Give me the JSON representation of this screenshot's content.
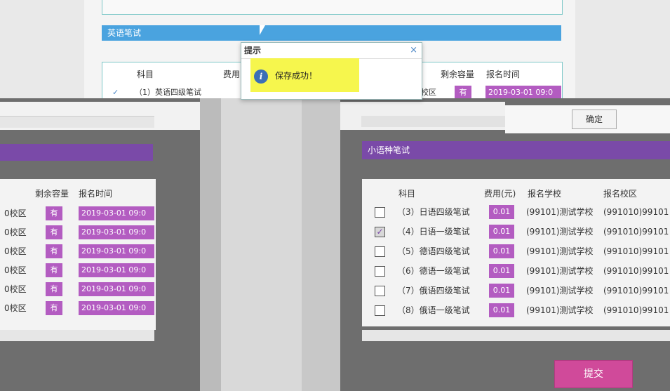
{
  "top": {
    "section_title": "英语笔试",
    "headers": {
      "subject": "科目",
      "fee": "费用",
      "remaining": "剩余容量",
      "time": "报名时间"
    },
    "row": {
      "subject": "（1）英语四级笔试",
      "campus_suffix": "校区",
      "remaining": "有",
      "time": "2019-03-01 09:0"
    }
  },
  "dialog": {
    "title": "提示",
    "close": "×",
    "icon": "info-icon",
    "message": "保存成功！"
  },
  "ok_button": "确定",
  "right": {
    "section_title": "小语种笔试",
    "headers": {
      "subject": "科目",
      "fee": "费用(元)",
      "school": "报名学校",
      "campus": "报名校区"
    },
    "rows": [
      {
        "checked": false,
        "subject": "（3）日语四级笔试",
        "fee": "0.01",
        "school": "(99101)测试学校",
        "campus": "(991010)99101"
      },
      {
        "checked": true,
        "subject": "（4）日语一级笔试",
        "fee": "0.01",
        "school": "(99101)测试学校",
        "campus": "(991010)99101"
      },
      {
        "checked": false,
        "subject": "（5）德语四级笔试",
        "fee": "0.01",
        "school": "(99101)测试学校",
        "campus": "(991010)99101"
      },
      {
        "checked": false,
        "subject": "（6）德语一级笔试",
        "fee": "0.01",
        "school": "(99101)测试学校",
        "campus": "(991010)99101"
      },
      {
        "checked": false,
        "subject": "（7）俄语四级笔试",
        "fee": "0.01",
        "school": "(99101)测试学校",
        "campus": "(991010)99101"
      },
      {
        "checked": false,
        "subject": "（8）俄语一级笔试",
        "fee": "0.01",
        "school": "(99101)测试学校",
        "campus": "(991010)99101"
      }
    ]
  },
  "left": {
    "headers": {
      "remaining": "剩余容量",
      "time": "报名时间"
    },
    "rows": [
      {
        "campus": "0校区",
        "remaining": "有",
        "time": "2019-03-01 09:0"
      },
      {
        "campus": "0校区",
        "remaining": "有",
        "time": "2019-03-01 09:0"
      },
      {
        "campus": "0校区",
        "remaining": "有",
        "time": "2019-03-01 09:0"
      },
      {
        "campus": "0校区",
        "remaining": "有",
        "time": "2019-03-01 09:0"
      },
      {
        "campus": "0校区",
        "remaining": "有",
        "time": "2019-03-01 09:0"
      },
      {
        "campus": "0校区",
        "remaining": "有",
        "time": "2019-03-01 09:0"
      }
    ]
  },
  "submit_button": "提交",
  "colors": {
    "accent_blue": "#4aa3df",
    "purple": "#7a4aa8",
    "pill": "#b35cc1",
    "submit": "#d04a9a",
    "highlight": "#f5f53a"
  }
}
